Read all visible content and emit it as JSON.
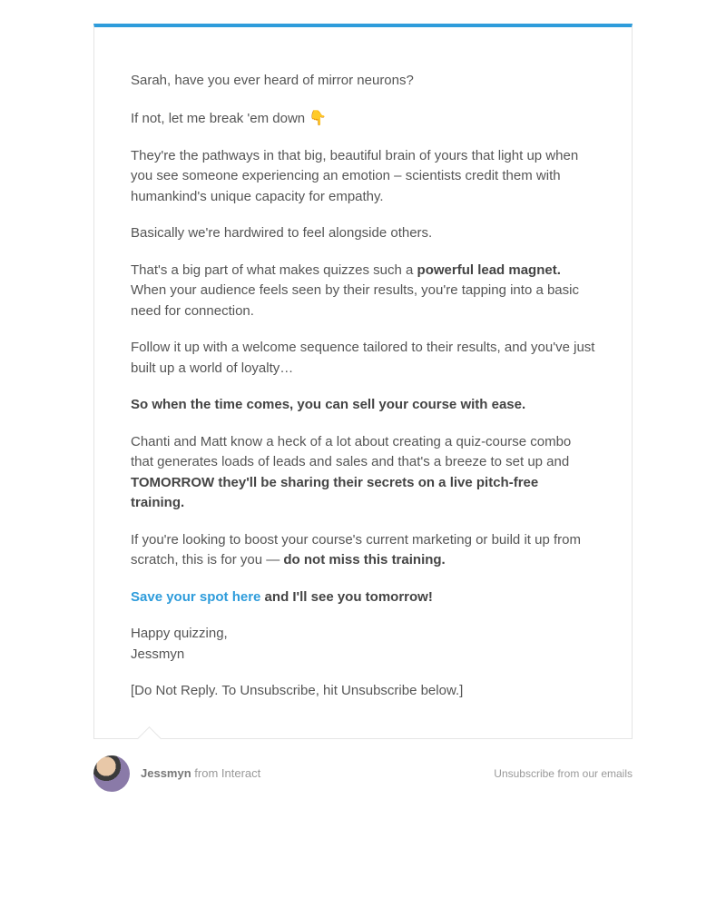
{
  "body": {
    "p1": "Sarah, have you ever heard of mirror neurons?",
    "p2_pre": "If not, let me break 'em down ",
    "emoji": "👇",
    "p3": "They're the pathways in that big, beautiful brain of yours that light up when you see someone experiencing an emotion – scientists credit them with humankind's unique capacity for empathy.",
    "p4": "Basically we're hardwired to feel alongside others.",
    "p5_pre": "That's a big part of what makes quizzes such a ",
    "p5_strong": "powerful lead magnet.",
    "p5_post": " When your audience feels seen by their results, you're tapping into a basic need for connection.",
    "p6": "Follow it up with a welcome sequence tailored to their results, and you've just built up a world of loyalty…",
    "p7_strong": "So when the time comes, you can sell your course with ease.",
    "p8_pre": "Chanti and Matt know a heck of a lot about creating a quiz-course combo that generates loads of leads and sales and that's a breeze to set up and ",
    "p8_strong": "TOMORROW they'll be sharing their secrets on a live pitch-free training.",
    "p9_pre": "If you're looking to boost your course's current marketing or build it up from scratch, this is for you — ",
    "p9_strong": "do not miss this training.",
    "p10_link": "Save your spot here",
    "p10_post": " and I'll see you tomorrow!",
    "p11": "Happy quizzing,",
    "p11b": "Jessmyn",
    "p12": "[Do Not Reply. To Unsubscribe, hit Unsubscribe below.]"
  },
  "footer": {
    "sender_name": "Jessmyn",
    "sender_from": " from Interact",
    "unsubscribe": "Unsubscribe from our emails"
  }
}
